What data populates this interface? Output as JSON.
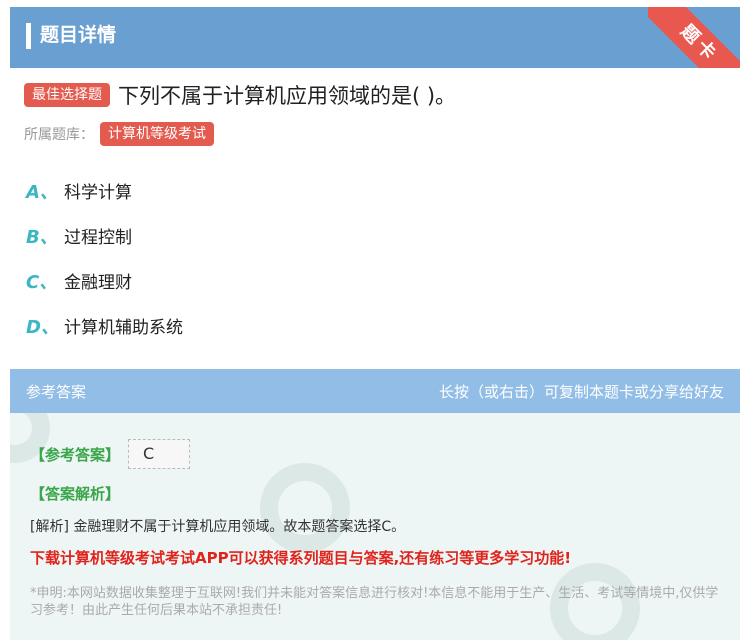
{
  "header": {
    "title": "题目详情",
    "corner_ribbon": "题卡"
  },
  "question": {
    "type_tag": "最佳选择题",
    "text": "下列不属于计算机应用领域的是( )。",
    "bank_label": "所属题库：",
    "bank_tag": "计算机等级考试"
  },
  "options": [
    {
      "letter": "A、",
      "text": "科学计算"
    },
    {
      "letter": "B、",
      "text": "过程控制"
    },
    {
      "letter": "C、",
      "text": "金融理财"
    },
    {
      "letter": "D、",
      "text": "计算机辅助系统"
    }
  ],
  "answer_section": {
    "title": "参考答案",
    "hint": "长按（或右击）可复制本题卡或分享给好友",
    "answer_label": "【参考答案】",
    "answer_value": "C",
    "analysis_label": "【答案解析】",
    "analysis_text": "[解析] 金融理财不属于计算机应用领域。故本题答案选择C。",
    "promo": "下载计算机等级考试考试APP可以获得系列题目与答案,还有练习等更多学习功能!",
    "disclaimer": "*申明:本网站数据收集整理于互联网!我们并未能对答案信息进行核对!本信息不能用于生产、生活、考试等情境中,仅供学习参考！由此产生任何后果本站不承担责任!"
  },
  "colors": {
    "header_bg": "#6a9fd1",
    "ribbon": "#e8584e",
    "tag_red": "#e35a4f",
    "option_letter": "#3bb6c3",
    "answer_header_bg": "#92bde6",
    "answer_body_bg": "#eef6f5",
    "green_label": "#3aa64a",
    "promo_red": "#e0231c"
  }
}
